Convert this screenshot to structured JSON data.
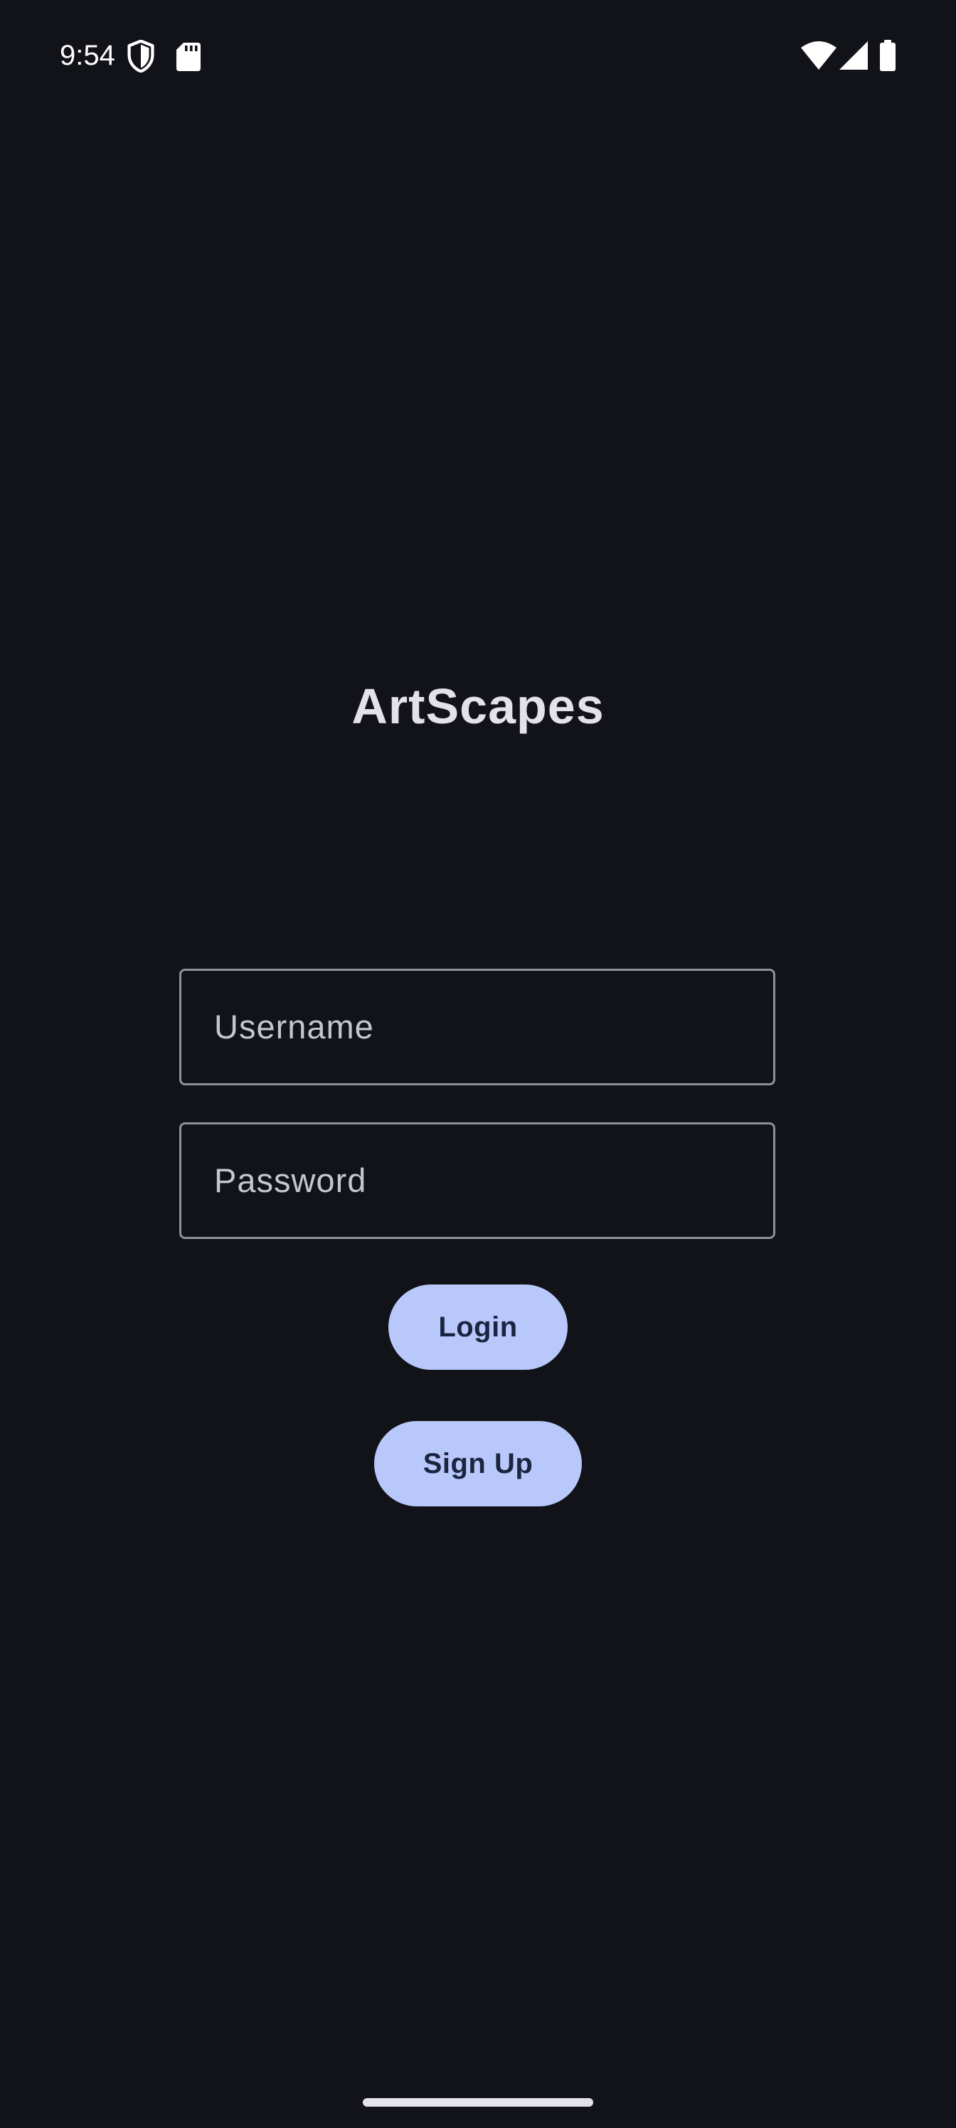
{
  "status_bar": {
    "time": "9:54",
    "icons": [
      "shield-icon",
      "sd-card-icon",
      "wifi-icon",
      "signal-icon",
      "battery-icon"
    ]
  },
  "app": {
    "title": "ArtScapes"
  },
  "form": {
    "username": {
      "value": "",
      "placeholder": "Username"
    },
    "password": {
      "value": "",
      "placeholder": "Password"
    },
    "login_label": "Login",
    "signup_label": "Sign Up"
  },
  "colors": {
    "background": "#121318",
    "button_fill": "#b8c8fa",
    "button_text": "#1b2541",
    "field_border": "#8e909a",
    "text_primary": "#e3e2e9",
    "placeholder_text": "#c4c6d0"
  }
}
